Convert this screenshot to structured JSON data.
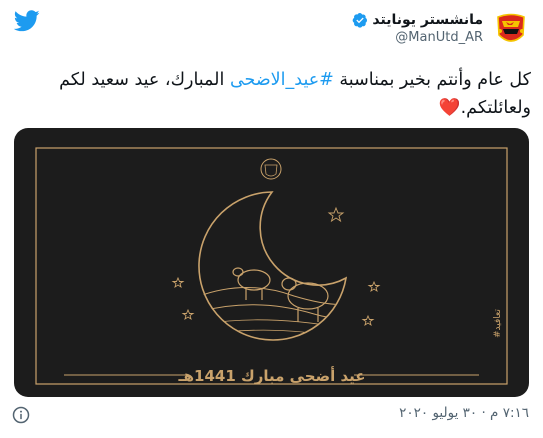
{
  "author": {
    "display_name": "مانشستر يونايتد",
    "handle": "@ManUtd_AR"
  },
  "tweet": {
    "text_part1": "كل عام وأنتم بخير بمناسبة ",
    "hashtag": "#عيد_الاضحى",
    "text_part2": " المبارك، عيد سعيد لكم ولعائلتكم.",
    "emoji": "❤️"
  },
  "media": {
    "greeting": "عيد أضحى مبارك 1441هـ",
    "side_tag": "#تعافيد"
  },
  "footer": {
    "timestamp": "٧:١٦ م · ٣٠ يوليو ٢٠٢٠"
  },
  "colors": {
    "twitter_blue": "#1d9bf0",
    "card_background": "#1c1c1c",
    "gold": "#c9a26b",
    "heart": "#e0245e"
  },
  "icons": [
    "twitter-bird-icon",
    "verified-badge-icon",
    "info-icon"
  ]
}
